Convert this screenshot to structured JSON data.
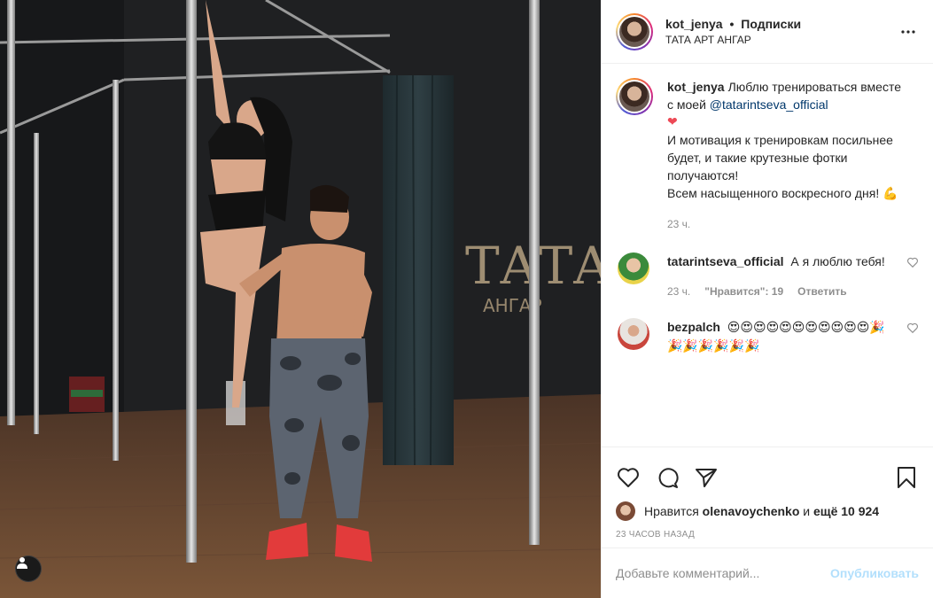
{
  "header": {
    "username": "kot_jenya",
    "separator": "•",
    "follow_label": "Подписки",
    "location": "ТАТА АРТ АНГАР",
    "more_icon": "more-horizontal-icon"
  },
  "photo": {
    "wall_sign_line1": "ТАТА",
    "wall_sign_line2": "АНГАР",
    "user_tag_icon": "user-icon"
  },
  "caption": {
    "username": "kot_jenya",
    "text_before_mention": "Люблю тренироваться вместе с моей ",
    "mention": "@tatarintseva_official",
    "heart": "❤",
    "line2": "И мотивация к тренировкам посильнее будет, и такие крутезные фотки получаются!",
    "line3": "Всем насыщенного воскресного дня!",
    "line3_emoji": "💪",
    "time": "23 ч."
  },
  "comments": [
    {
      "username": "tatarintseva_official",
      "text": "А я люблю тебя!",
      "time": "23 ч.",
      "likes": "\"Нравится\": 19",
      "reply_label": "Ответить"
    },
    {
      "username": "bezpalch",
      "text": "😍😍😍😍😍😍😍😍😍😍😍🎉🎉🎉🎉🎉🎉🎉",
      "time": "",
      "likes": "",
      "reply_label": ""
    }
  ],
  "actions": {
    "like_icon": "heart-icon",
    "comment_icon": "comment-icon",
    "share_icon": "share-icon",
    "save_icon": "bookmark-icon"
  },
  "likes": {
    "prefix": "Нравится",
    "user": "olenavoychenko",
    "connector": "и",
    "rest": "ещё 10 924"
  },
  "timestamp": "23 ЧАСОВ НАЗАД",
  "add_comment": {
    "placeholder": "Добавьте комментарий...",
    "publish_label": "Опубликовать"
  },
  "colors": {
    "link": "#00376b",
    "muted": "#8e8e8e",
    "publish_disabled": "#b2dffc",
    "heart_red": "#ed4956"
  }
}
